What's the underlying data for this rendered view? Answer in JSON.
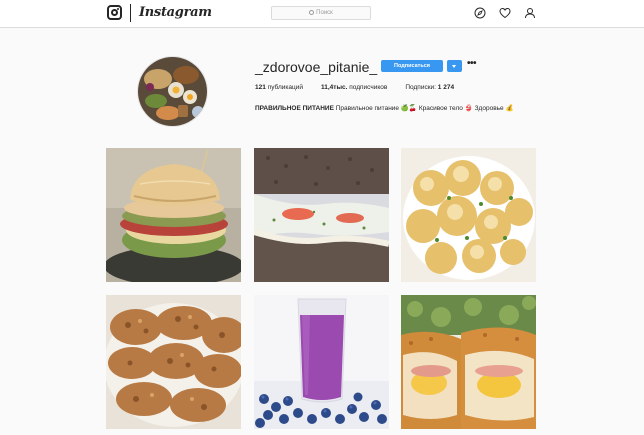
{
  "app": {
    "name": "Instagram",
    "search_placeholder": "Поиск"
  },
  "profile": {
    "username": "_zdorovoe_pitanie_",
    "follow_label": "Подписаться",
    "more_label": "•••",
    "stats": {
      "posts_value": "121",
      "posts_label": "публикаций",
      "followers_value": "11,4тыс.",
      "followers_label": "подписчиков",
      "following_label": "Подписки:",
      "following_value": "1 274"
    },
    "bio": {
      "title": "ПРАВИЛЬНОЕ ПИТАНИЕ",
      "text": "Правильное питание 🍏🍒 Красивое тело 👙 Здоровье 💰"
    }
  },
  "posts": [
    {
      "subject": "sandwich-stack"
    },
    {
      "subject": "rye-crispbread-sandwich"
    },
    {
      "subject": "baked-cauliflower"
    },
    {
      "subject": "meat-patties"
    },
    {
      "subject": "blueberry-smoothie"
    },
    {
      "subject": "stuffed-chicken-cutlet"
    }
  ],
  "colors": {
    "accent": "#3897f0",
    "text": "#262626",
    "border": "#dbdbdb",
    "background": "#fafafa"
  }
}
